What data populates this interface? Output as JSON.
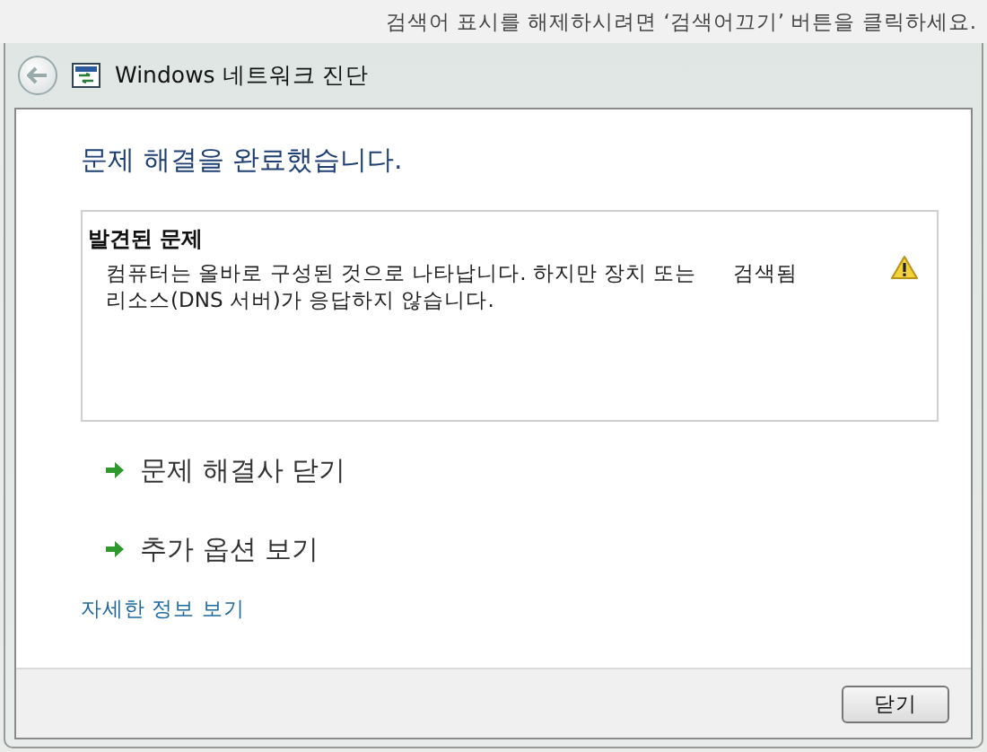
{
  "banner": {
    "text": "검색어 표시를 해제하시려면 ‘검색어끄기’ 버튼을 클릭하세요."
  },
  "window": {
    "title": "Windows 네트워크 진단"
  },
  "heading": "문제 해결을 완료했습니다.",
  "problems": {
    "label": "발견된 문제",
    "segments": [
      "컴퓨터는 올바로 구성된 것으로 나타납니다. 하지만 장치 또는",
      "검색됨",
      "리소스(DNS 서버)가 응답하지 않습니다."
    ]
  },
  "options": [
    {
      "label": "문제 해결사 닫기"
    },
    {
      "label": "추가 옵션 보기"
    }
  ],
  "details_link": "자세한 정보 보기",
  "buttons": [
    "닫기"
  ]
}
